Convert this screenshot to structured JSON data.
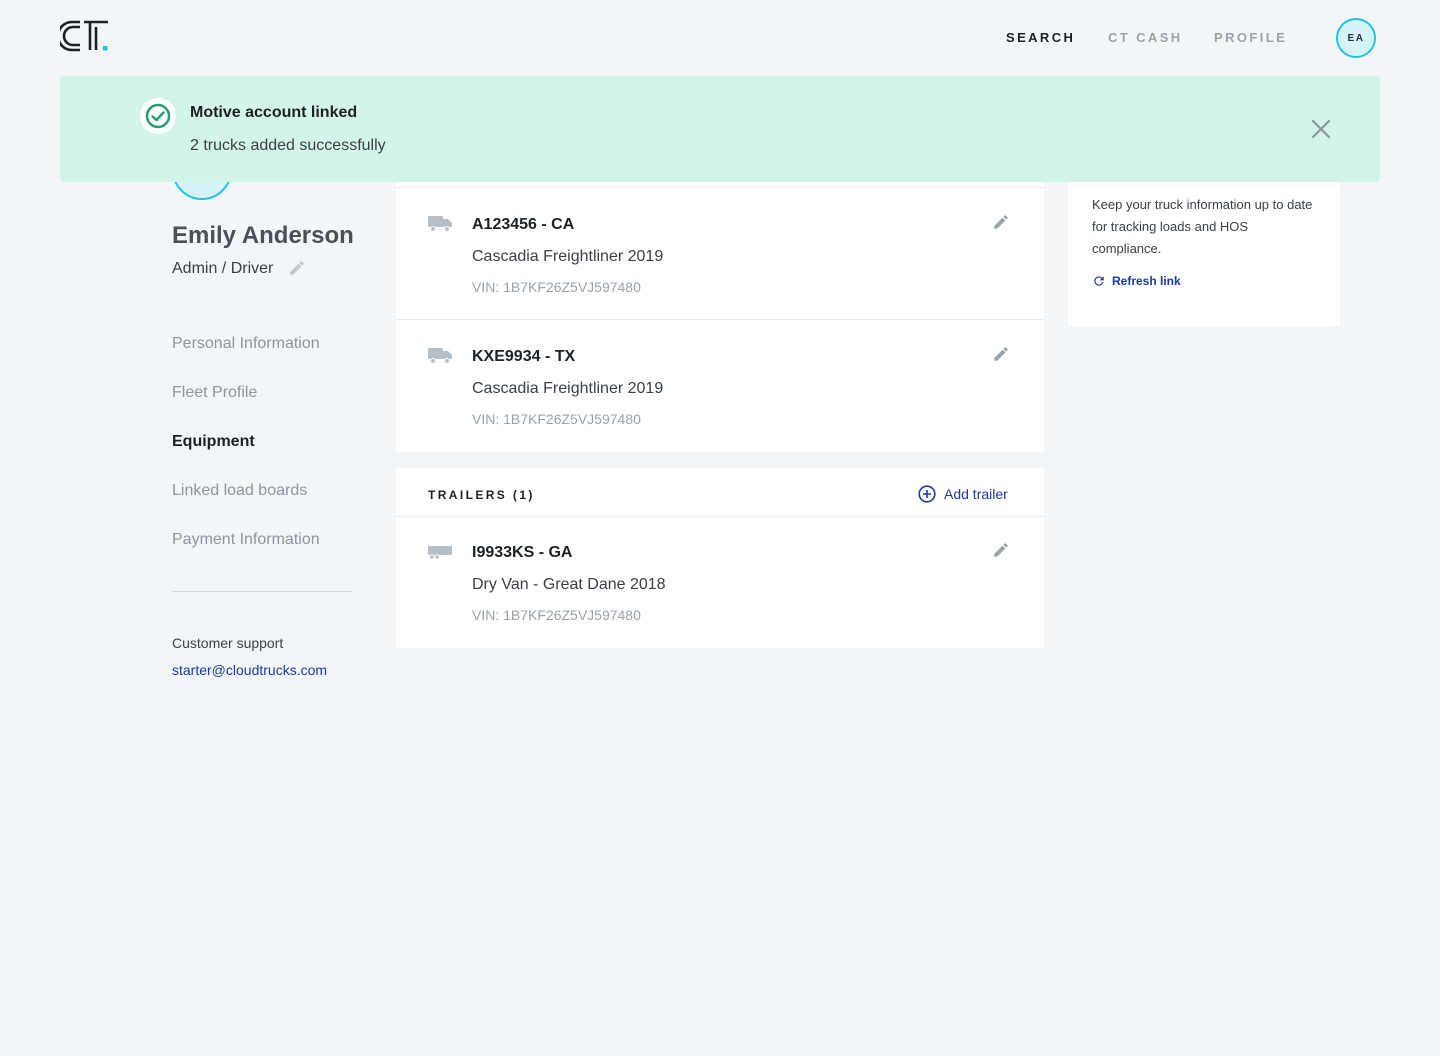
{
  "nav": {
    "search": "SEARCH",
    "cash": "CT CASH",
    "profile": "PROFILE",
    "avatar_initials": "EA"
  },
  "user": {
    "name": "Emily Anderson",
    "role": "Admin / Driver"
  },
  "sidebar": {
    "items": [
      {
        "label": "Personal Information",
        "active": false
      },
      {
        "label": "Fleet Profile",
        "active": false
      },
      {
        "label": "Equipment",
        "active": true
      },
      {
        "label": "Linked load boards",
        "active": false
      },
      {
        "label": "Payment Information",
        "active": false
      }
    ],
    "support_label": "Customer support",
    "support_email": "starter@cloudtrucks.com"
  },
  "trucks": [
    {
      "plate": "A123456 - CA",
      "model": "Cascadia Freightliner 2019",
      "vin": "VIN: 1B7KF26Z5VJ597480"
    },
    {
      "plate": "KXE9934 - TX",
      "model": "Cascadia Freightliner 2019",
      "vin": "VIN: 1B7KF26Z5VJ597480"
    }
  ],
  "trailers": {
    "title": "TRAILERS (1)",
    "add_label": "Add trailer",
    "items": [
      {
        "plate": "I9933KS - GA",
        "model": "Dry Van - Great Dane 2018",
        "vin": "VIN: 1B7KF26Z5VJ597480"
      }
    ]
  },
  "info": {
    "text": "Keep your truck information up to date for tracking loads and HOS compliance.",
    "refresh_label": "Refresh link"
  },
  "toast": {
    "title": "Motive account linked",
    "message": "2 trucks added successfully"
  },
  "colors": {
    "accent": "#27c3dc",
    "link": "#1a3aa8",
    "toast_bg": "#d3f5e9",
    "success": "#1f9d6b"
  }
}
